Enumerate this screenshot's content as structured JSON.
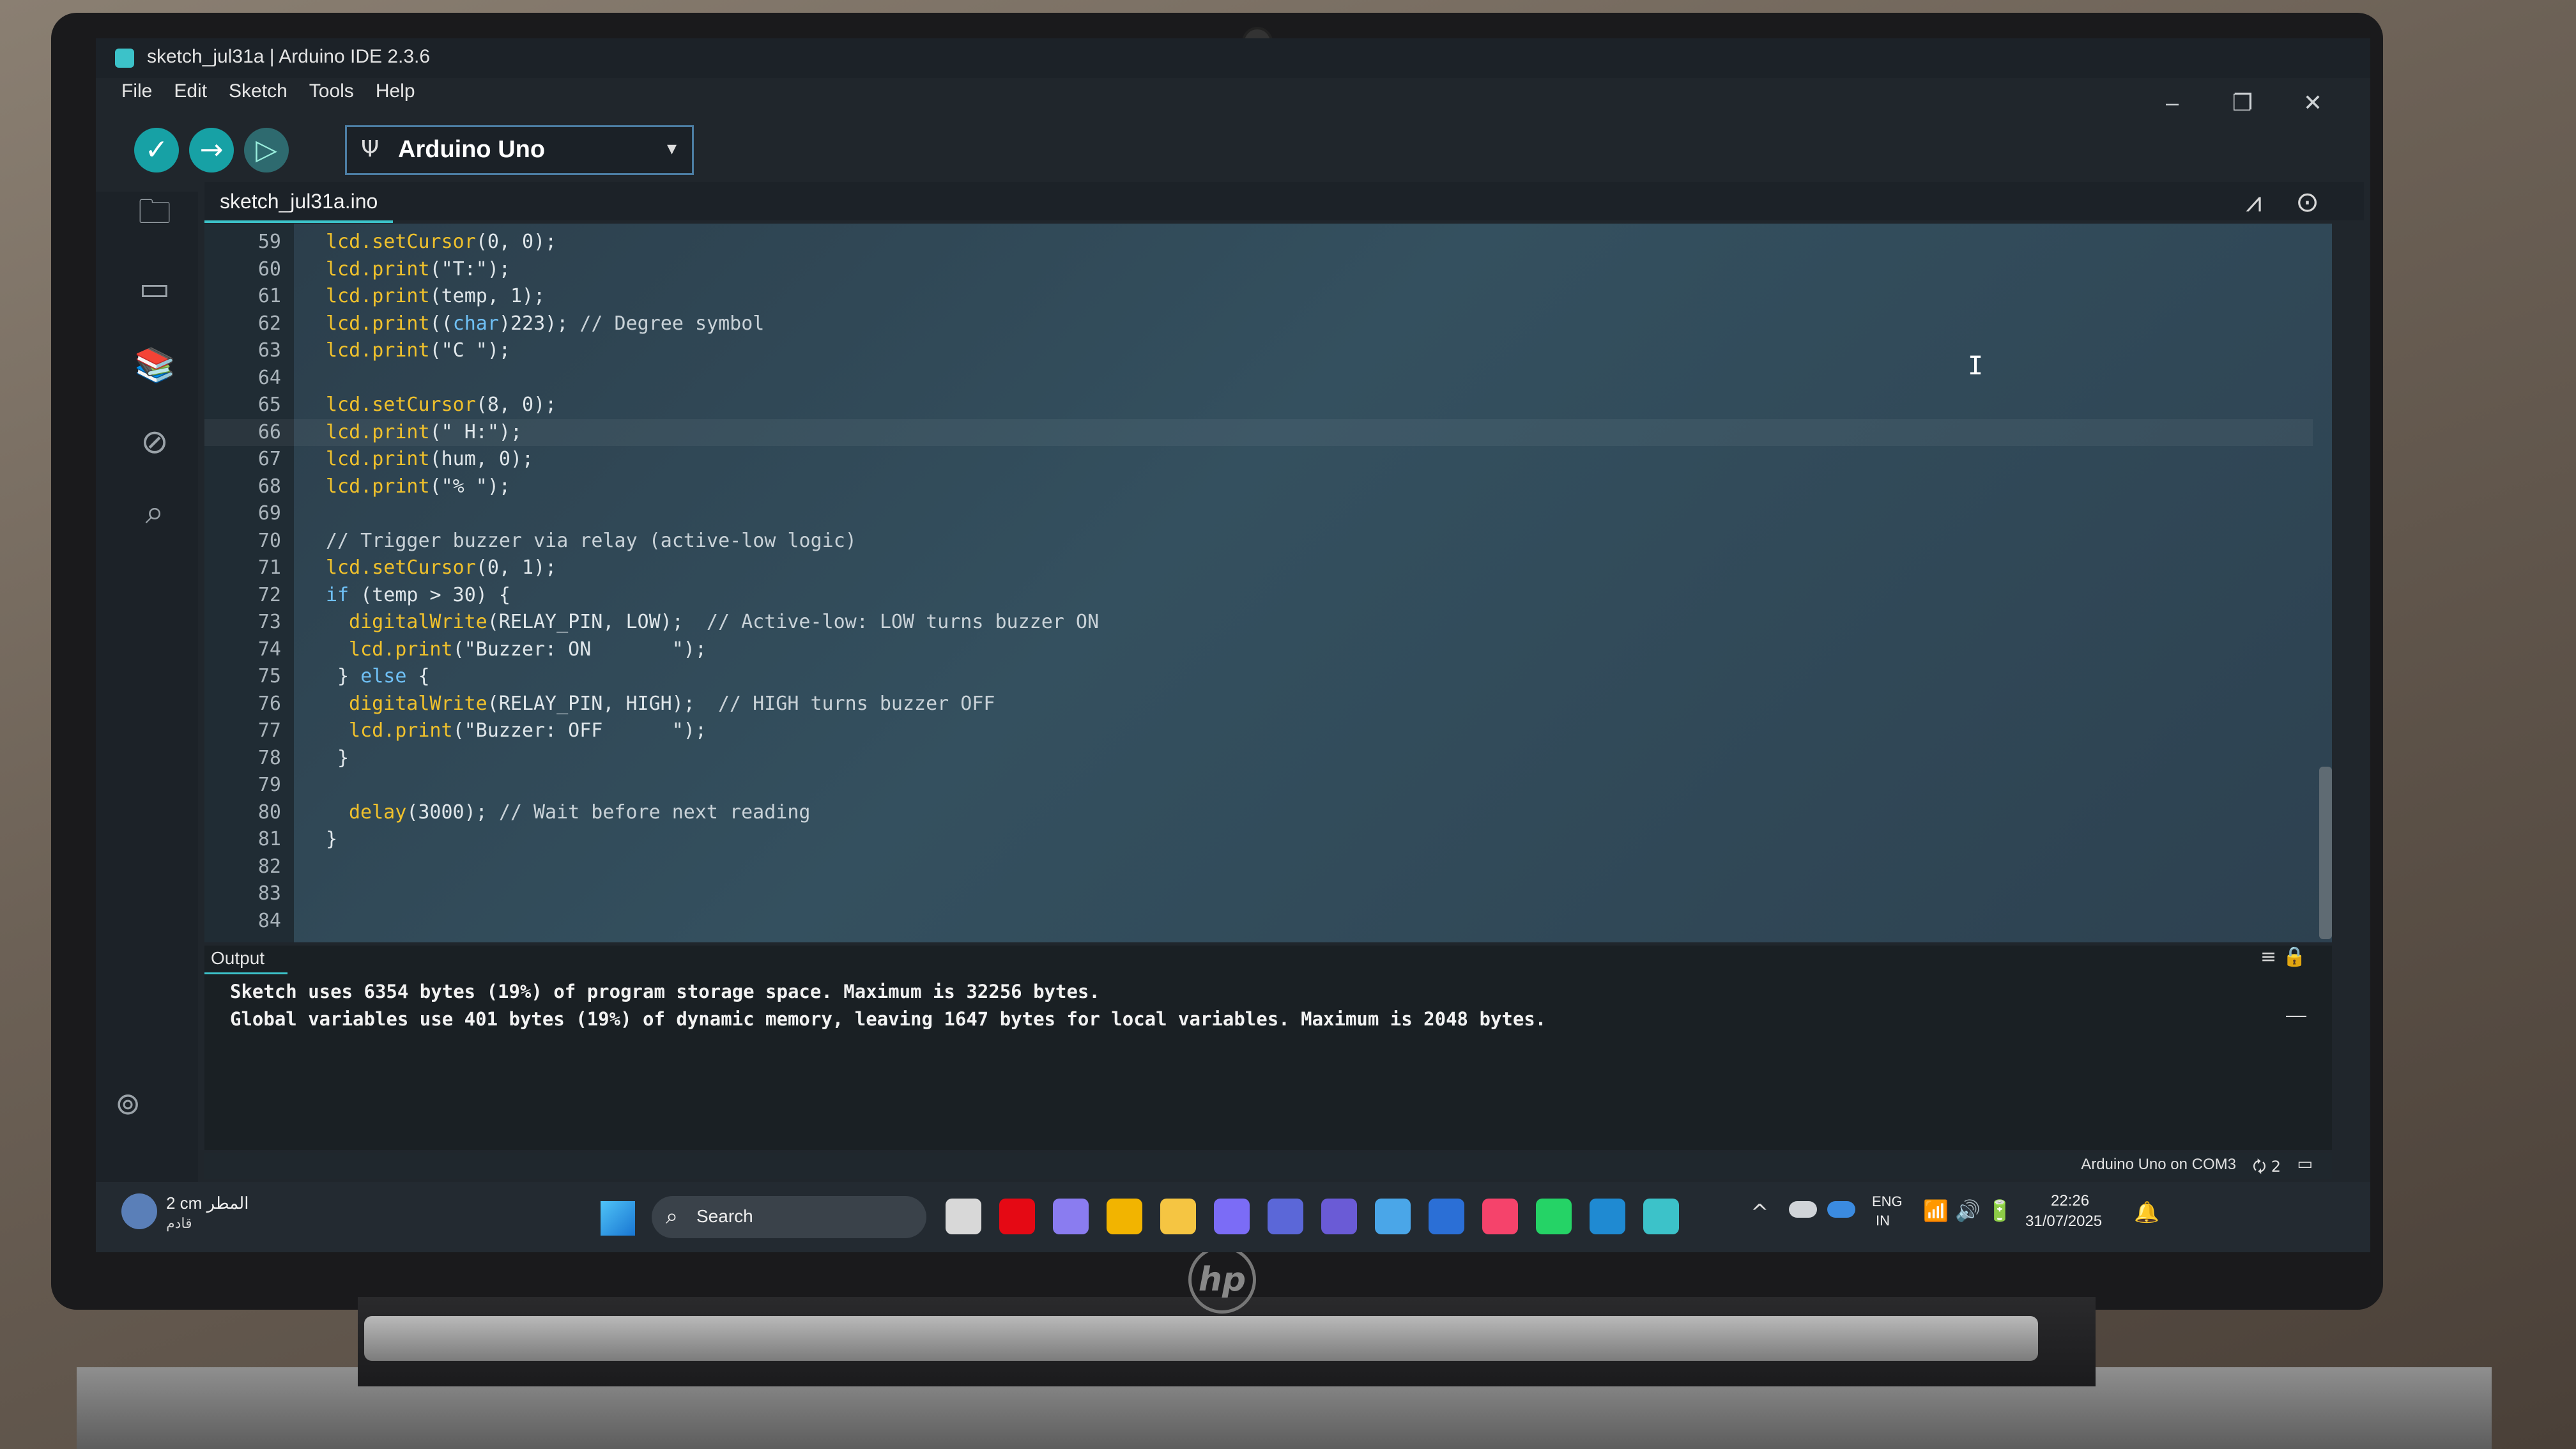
{
  "window": {
    "title": "sketch_jul31a | Arduino IDE 2.3.6",
    "controls": {
      "minimize": "–",
      "maximize": "❐",
      "close": "✕"
    }
  },
  "menu": [
    "File",
    "Edit",
    "Sketch",
    "Tools",
    "Help"
  ],
  "toolbar": {
    "verify_glyph": "✓",
    "upload_glyph": "→",
    "debug_glyph": "▷",
    "board": "Arduino Uno",
    "board_icon": "usb-icon",
    "chevron": "▾"
  },
  "tab": {
    "filename": "sketch_jul31a.ino"
  },
  "editor": {
    "lines": [
      {
        "n": "59",
        "indent": 0,
        "segments": [
          [
            "fn",
            "lcd.setCursor"
          ],
          [
            "",
            "(0, 0);"
          ]
        ]
      },
      {
        "n": "60",
        "indent": 0,
        "segments": [
          [
            "fn",
            "lcd.print"
          ],
          [
            "",
            "(\"T:\");"
          ]
        ]
      },
      {
        "n": "61",
        "indent": 0,
        "segments": [
          [
            "fn",
            "lcd.print"
          ],
          [
            "",
            "(temp, 1);"
          ]
        ]
      },
      {
        "n": "62",
        "indent": 0,
        "segments": [
          [
            "fn",
            "lcd.print"
          ],
          [
            "",
            "(("
          ],
          [
            "kw",
            "char"
          ],
          [
            "",
            ")223); "
          ],
          [
            "cm",
            "// Degree symbol"
          ]
        ]
      },
      {
        "n": "63",
        "indent": 0,
        "segments": [
          [
            "fn",
            "lcd.print"
          ],
          [
            "",
            "(\"C \");"
          ]
        ]
      },
      {
        "n": "64",
        "indent": 0,
        "segments": []
      },
      {
        "n": "65",
        "indent": 0,
        "segments": [
          [
            "fn",
            "lcd.setCursor"
          ],
          [
            "",
            "(8, 0);"
          ]
        ]
      },
      {
        "n": "66",
        "indent": 0,
        "segments": [
          [
            "fn",
            "lcd.print"
          ],
          [
            "",
            "(\" H:\");"
          ]
        ]
      },
      {
        "n": "67",
        "indent": 0,
        "segments": [
          [
            "fn",
            "lcd.print"
          ],
          [
            "",
            "(hum, 0);"
          ]
        ]
      },
      {
        "n": "68",
        "indent": 0,
        "segments": [
          [
            "fn",
            "lcd.print"
          ],
          [
            "",
            "(\"% \");"
          ]
        ]
      },
      {
        "n": "69",
        "indent": 0,
        "segments": []
      },
      {
        "n": "70",
        "indent": 0,
        "segments": [
          [
            "cm",
            "// Trigger buzzer via relay (active-low logic)"
          ]
        ]
      },
      {
        "n": "71",
        "indent": 0,
        "segments": [
          [
            "fn",
            "lcd.setCursor"
          ],
          [
            "",
            "(0, 1);"
          ]
        ]
      },
      {
        "n": "72",
        "indent": 0,
        "segments": [
          [
            "kw",
            "if"
          ],
          [
            "",
            " (temp > 30) {"
          ]
        ]
      },
      {
        "n": "73",
        "indent": 1,
        "segments": [
          [
            "fn",
            "digitalWrite"
          ],
          [
            "",
            "(RELAY_PIN, LOW);  "
          ],
          [
            "cm",
            "// Active-low: LOW turns buzzer ON"
          ]
        ]
      },
      {
        "n": "74",
        "indent": 1,
        "segments": [
          [
            "fn",
            "lcd.print"
          ],
          [
            "",
            "(\"Buzzer: ON       \");"
          ]
        ]
      },
      {
        "n": "75",
        "indent": 0,
        "segments": [
          [
            "",
            " } "
          ],
          [
            "kw",
            "else"
          ],
          [
            "",
            " {"
          ]
        ]
      },
      {
        "n": "76",
        "indent": 1,
        "segments": [
          [
            "fn",
            "digitalWrite"
          ],
          [
            "",
            "(RELAY_PIN, HIGH);  "
          ],
          [
            "cm",
            "// HIGH turns buzzer OFF"
          ]
        ]
      },
      {
        "n": "77",
        "indent": 1,
        "segments": [
          [
            "fn",
            "lcd.print"
          ],
          [
            "",
            "(\"Buzzer: OFF      \");"
          ]
        ]
      },
      {
        "n": "78",
        "indent": 0,
        "segments": [
          [
            "",
            " }"
          ]
        ]
      },
      {
        "n": "79",
        "indent": 0,
        "segments": []
      },
      {
        "n": "80",
        "indent": 1,
        "segments": [
          [
            "fn",
            "delay"
          ],
          [
            "",
            "(3000); "
          ],
          [
            "cm",
            "// Wait before next reading"
          ]
        ]
      },
      {
        "n": "81",
        "indent": 0,
        "segments": [
          [
            "",
            "}"
          ]
        ]
      },
      {
        "n": "82",
        "indent": 0,
        "segments": []
      },
      {
        "n": "83",
        "indent": 0,
        "segments": []
      },
      {
        "n": "84",
        "indent": 0,
        "segments": []
      }
    ],
    "active_line": "66",
    "cursor_glyph": "I"
  },
  "output": {
    "title": "Output",
    "lines": [
      "Sketch uses 6354 bytes (19%) of program storage space. Maximum is 32256 bytes.",
      "Global variables use 401 bytes (19%) of dynamic memory, leaving 1647 bytes for local variables. Maximum is 2048 bytes."
    ],
    "tools_glyph": "≡ 🔒",
    "minimize_glyph": "—"
  },
  "statusbar": {
    "board_port": "Arduino Uno on COM3",
    "notifications": "🗘 2",
    "panel_glyph": "▭"
  },
  "taskbar": {
    "weather_temp": "2 cm المطر",
    "weather_desc": "قادم",
    "search_placeholder": "Search",
    "lang_code": "ENG",
    "lang_region": "IN",
    "time": "22:26",
    "date": "31/07/2025",
    "tray_glyphs": "📶 🔊 🔋",
    "chevron": "^",
    "bell": "🔔",
    "apps": [
      {
        "name": "task-view",
        "color": "#d8d8d8"
      },
      {
        "name": "netflix",
        "color": "#e50914"
      },
      {
        "name": "copilot",
        "color": "#8a7cf0"
      },
      {
        "name": "chrome",
        "color": "#f2b400"
      },
      {
        "name": "file-explorer",
        "color": "#f5c542"
      },
      {
        "name": "clipchamp",
        "color": "#7b6cf6"
      },
      {
        "name": "teams",
        "color": "#5b67d8"
      },
      {
        "name": "phone-link",
        "color": "#6a5bd6"
      },
      {
        "name": "photos",
        "color": "#4aa6e8"
      },
      {
        "name": "word",
        "color": "#2b6fd6"
      },
      {
        "name": "apple-music",
        "color": "#f5436b"
      },
      {
        "name": "whatsapp",
        "color": "#25d366"
      },
      {
        "name": "vscode",
        "color": "#1f8ad2"
      },
      {
        "name": "arduino-ide",
        "color": "#3cc2c9"
      }
    ]
  },
  "hp_logo": "hp"
}
